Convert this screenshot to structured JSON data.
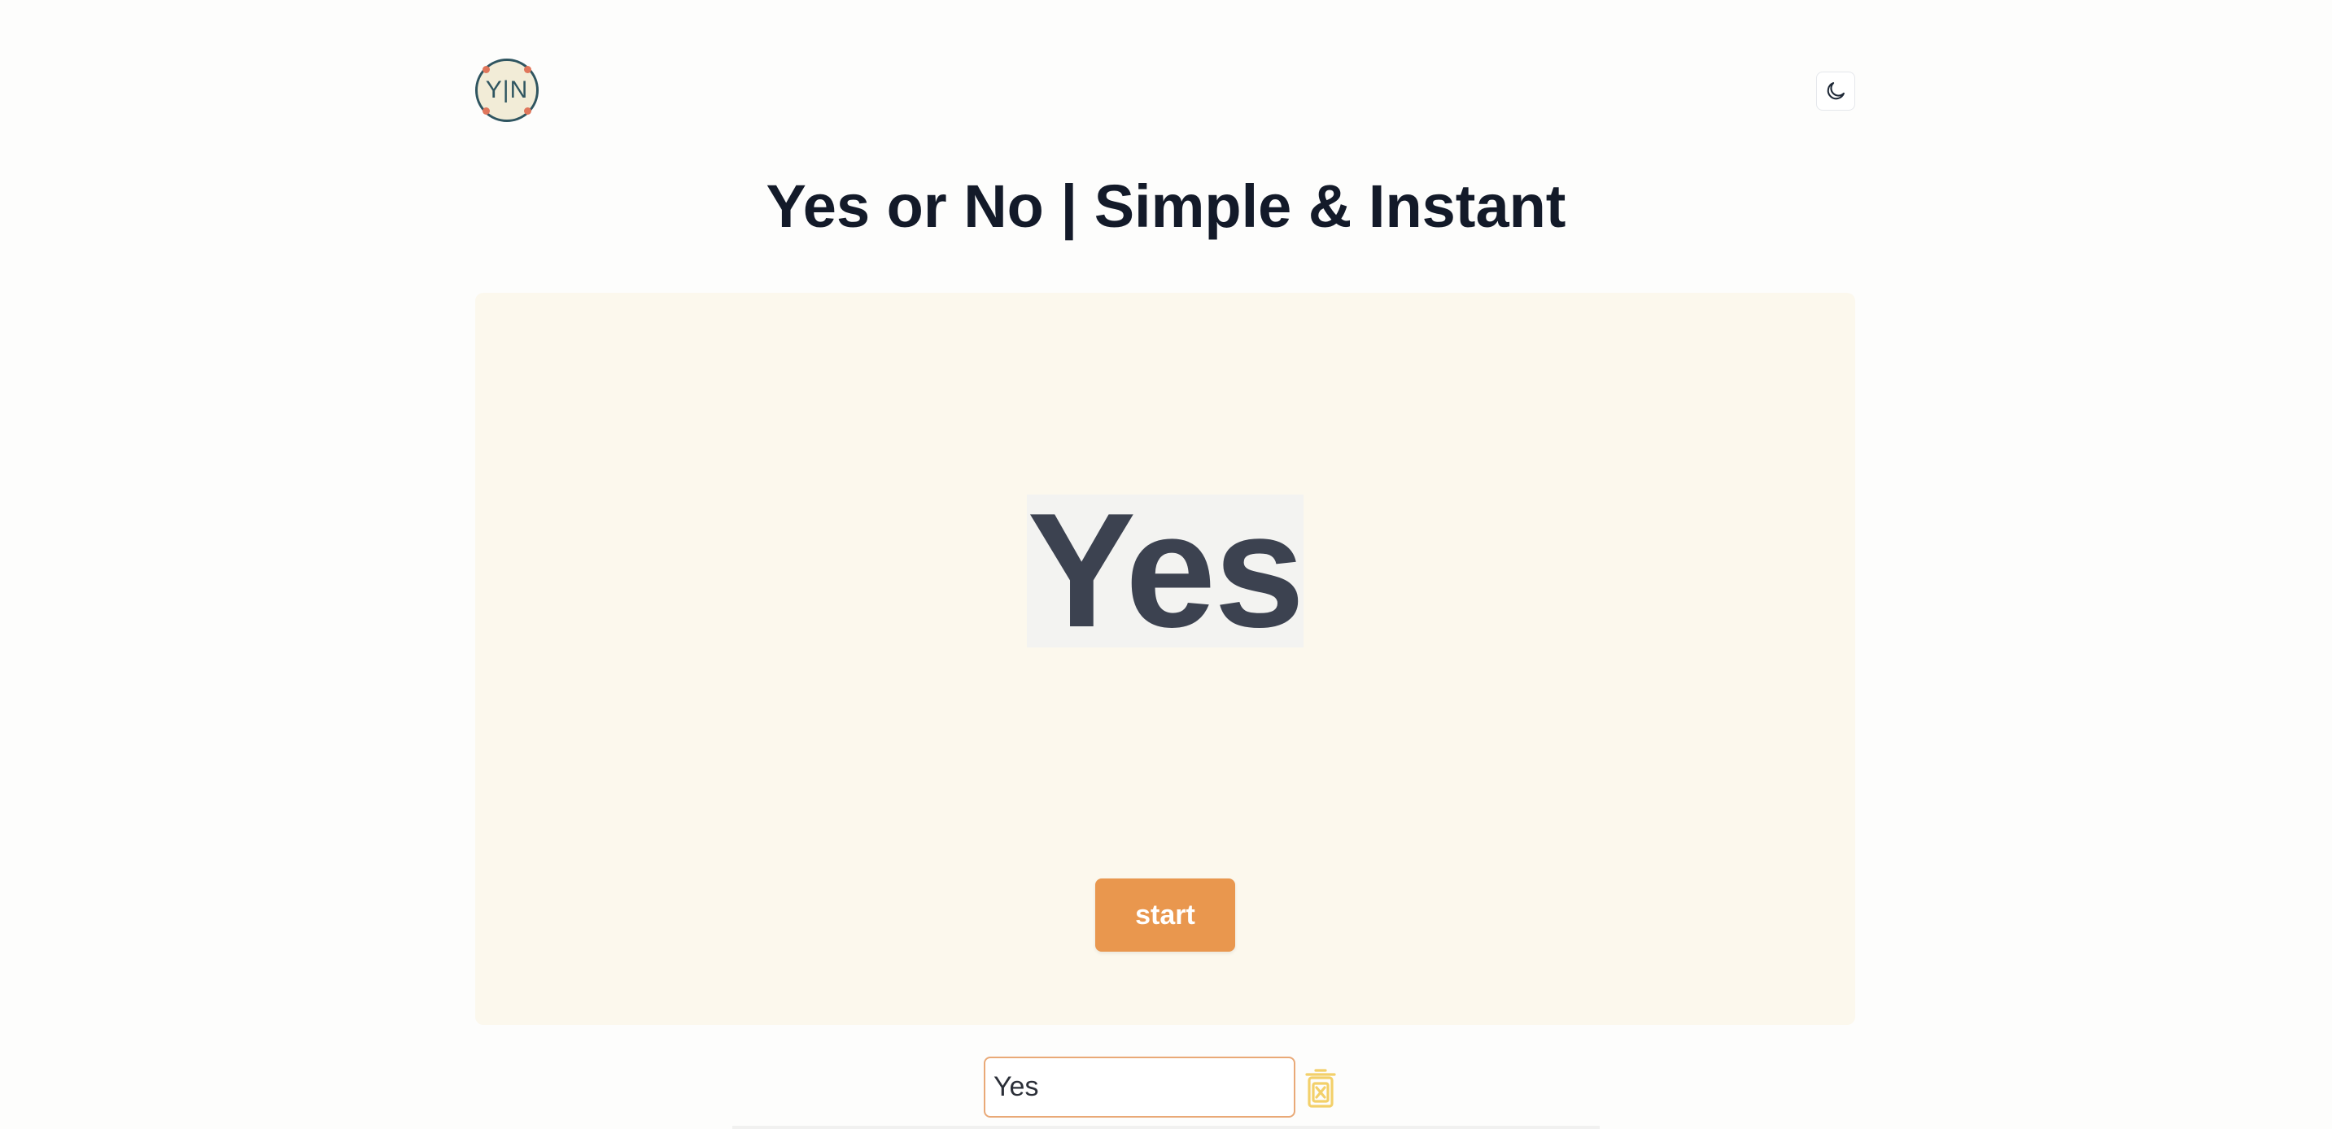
{
  "header": {
    "logo_text": "Y|N",
    "theme_toggle_icon": "moon-icon"
  },
  "page": {
    "title": "Yes or No | Simple & Instant"
  },
  "stage": {
    "answer": "Yes",
    "start_label": "start"
  },
  "options": {
    "items": [
      {
        "value": "Yes",
        "delete_icon": "trash-x-icon"
      }
    ]
  },
  "colors": {
    "accent": "#e9974e",
    "stage_background": "#fcf8ed",
    "title_text": "#131a29",
    "answer_text": "#3c4250",
    "delete_icon": "#f3d06a",
    "logo_ring": "#2f5560"
  }
}
